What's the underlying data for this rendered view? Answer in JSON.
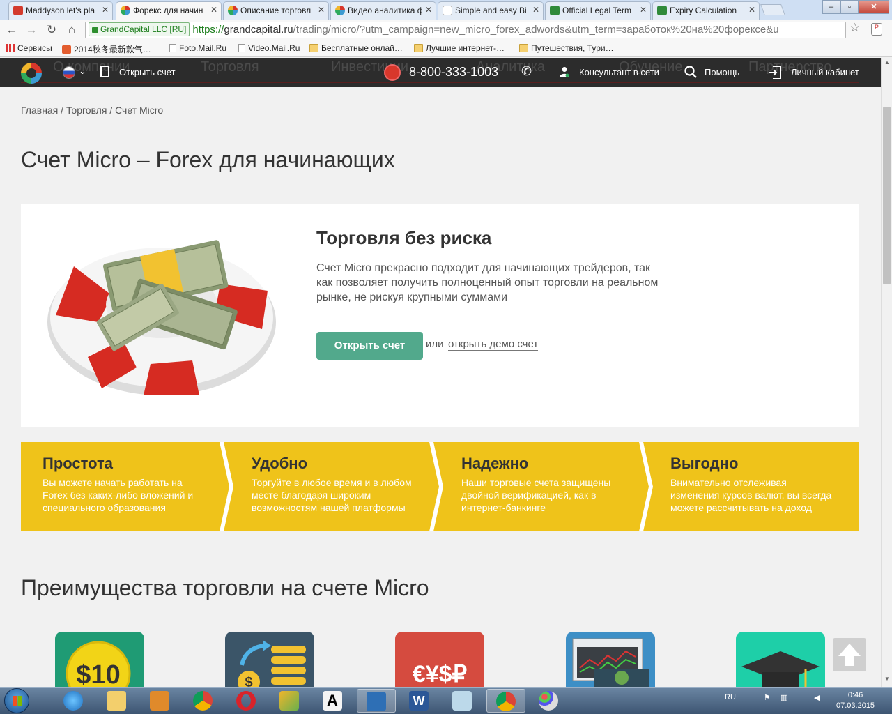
{
  "browser": {
    "tabs": [
      {
        "label": "Maddyson let's pla",
        "favicon_color": "#d33a2c"
      },
      {
        "label": "Форекс для начин",
        "favicon_color": "#e0402f",
        "active": true
      },
      {
        "label": "Описание торговл",
        "favicon_color": "#e0402f"
      },
      {
        "label": "Видео аналитика ф",
        "favicon_color": "#e0402f"
      },
      {
        "label": "Simple and easy Bi",
        "favicon_color": "#ffffff"
      },
      {
        "label": "Official Legal Term",
        "favicon_color": "#2f8a3a"
      },
      {
        "label": "Expiry Calculation",
        "favicon_color": "#2f8a3a"
      }
    ],
    "window_controls": {
      "minimize": "–",
      "restore": "▫",
      "close": "✕"
    },
    "ev_label": "GrandCapital LLC [RU]",
    "url_scheme": "https://",
    "url_host": "grandcapital.ru",
    "url_rest": "/trading/micro/?utm_campaign=new_micro_forex_adwords&utm_term=заработок%20на%20форексе&u",
    "bookmarks": [
      {
        "label": "Сервисы",
        "icon": "apps-icon"
      },
      {
        "label": "2014秋冬最新款气…",
        "icon": "tmall-icon"
      },
      {
        "label": "Foto.Mail.Ru",
        "icon": "page-icon"
      },
      {
        "label": "Video.Mail.Ru",
        "icon": "page-icon"
      },
      {
        "label": "Бесплатные онлай…",
        "icon": "folder-icon"
      },
      {
        "label": "Лучшие интернет-…",
        "icon": "folder-icon"
      },
      {
        "label": "Путешествия, Тури…",
        "icon": "folder-icon"
      }
    ]
  },
  "site": {
    "nav": {
      "ghost_menu": [
        "О компании",
        "Торговля",
        "Инвестиции",
        "Аналитика",
        "Обучение",
        "Партнерство"
      ],
      "open_account": "Открыть счет",
      "phone": "8-800-333-1003",
      "consultant": "Консультант в сети",
      "help": "Помощь",
      "cabinet": "Личный кабинет"
    },
    "breadcrumb": "Главная / Торговля / Счет Micro",
    "title": "Счет Micro – Forex для начинающих",
    "hero": {
      "heading": "Торговля без риска",
      "text": "Счет Micro прекрасно подходит для начинающих трейдеров, так как позволяет получить полноценный опыт торговли на реальном рынке, не рискуя крупными суммами",
      "cta": "Открыть счет",
      "or": "или",
      "demo_link": "открыть демо счет"
    },
    "features": [
      {
        "title": "Простота",
        "text": "Вы можете начать работать на Forex без каких-либо вложений и специального образования"
      },
      {
        "title": "Удобно",
        "text": "Торгуйте в любое время и в любом месте благодаря широким возможностям нашей платформы"
      },
      {
        "title": "Надежно",
        "text": "Наши торговые счета защищены двойной верификацией, как в интернет-банкинге"
      },
      {
        "title": "Выгодно",
        "text": "Внимательно отслеживая изменения курсов валют, вы всегда можете рассчитывать на доход"
      }
    ],
    "advantages_title": "Преимущества торговли на счете Micro",
    "tiles": [
      {
        "icon": "ten-dollar-coin-icon",
        "color": "#1f9b74",
        "text": "$10"
      },
      {
        "icon": "coin-stack-icon",
        "color": "#3b5568"
      },
      {
        "icon": "currency-symbols-icon",
        "color": "#d54b3f",
        "text": "€¥$₽"
      },
      {
        "icon": "trading-chart-icon",
        "color": "#3d8fc6"
      },
      {
        "icon": "graduation-cap-icon",
        "color": "#1ecfa8"
      }
    ],
    "scroll_top_icon": "arrow-up-icon"
  },
  "taskbar": {
    "apps": [
      "ie-icon",
      "explorer-icon",
      "media-player-icon",
      "chrome-icon",
      "opera-icon",
      "butterfly-app-icon",
      "font-app-icon",
      "txt-ru-icon",
      "word-icon",
      "notepad-icon",
      "chrome-icon",
      "paint-icon"
    ],
    "language": "RU",
    "time": "0:46",
    "date": "07.03.2015"
  },
  "colors": {
    "accent_green": "#52a98c",
    "feature_yellow": "#efc31a",
    "nav_dark": "#2c2c2c"
  }
}
